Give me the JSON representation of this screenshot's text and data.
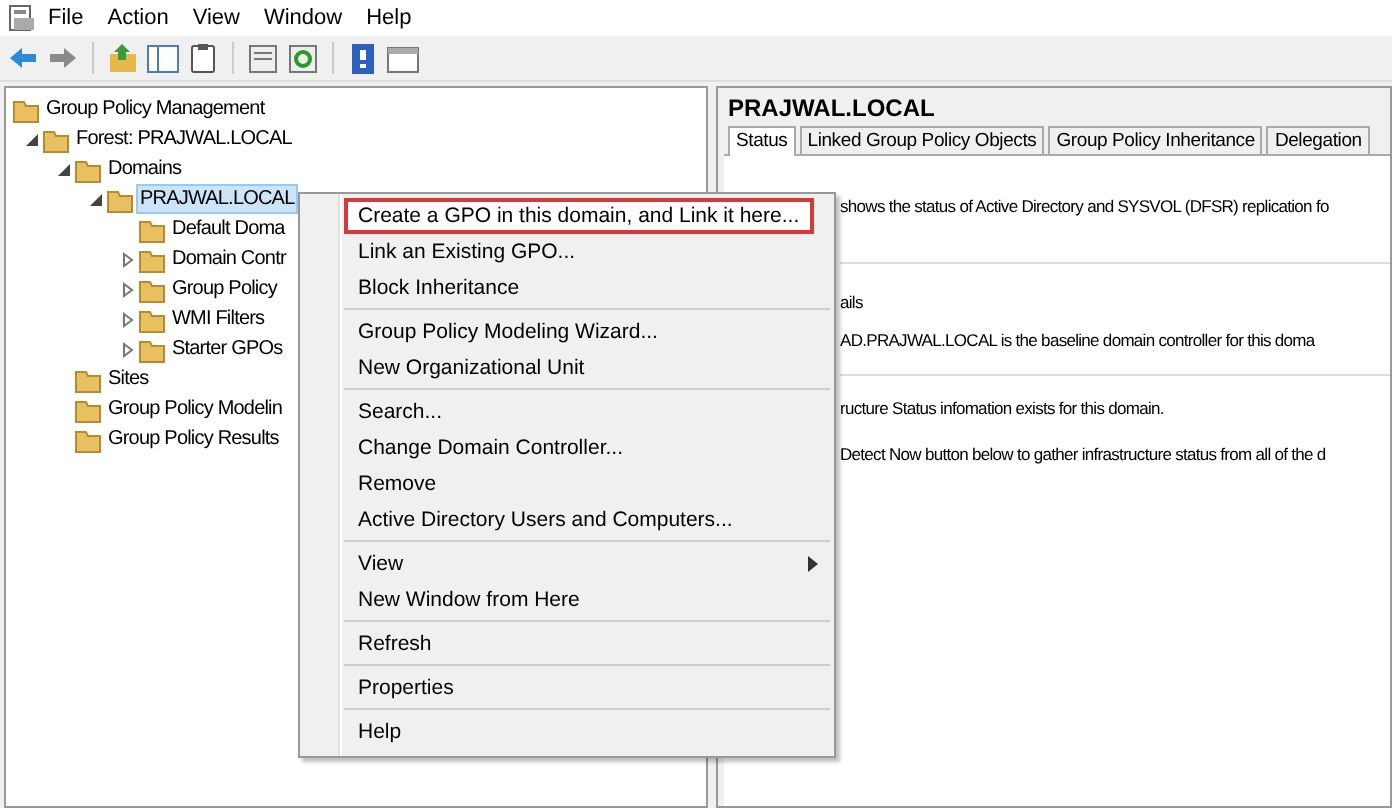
{
  "menu_bar": [
    "File",
    "Action",
    "View",
    "Window",
    "Help"
  ],
  "tree": [
    {
      "label": "Group Policy Management",
      "selected": false,
      "children": [
        {
          "label": "Forest: PRAJWAL.LOCAL",
          "expanded": true,
          "selected": false,
          "children": [
            {
              "label": "Domains",
              "expanded": true,
              "selected": false,
              "children": [
                {
                  "label": "PRAJWAL.LOCAL",
                  "expanded": true,
                  "selected": true,
                  "children": [
                    {
                      "label": "Default Doma",
                      "selected": false
                    },
                    {
                      "label": "Domain Contr",
                      "expanded": false,
                      "selected": false
                    },
                    {
                      "label": "Group Policy",
                      "expanded": false,
                      "selected": false
                    },
                    {
                      "label": "WMI Filters",
                      "expanded": false,
                      "selected": false
                    },
                    {
                      "label": "Starter GPOs",
                      "expanded": false,
                      "selected": false
                    }
                  ]
                }
              ]
            },
            {
              "label": "Sites",
              "selected": false
            },
            {
              "label": "Group Policy Modelin",
              "selected": false
            },
            {
              "label": "Group Policy Results",
              "selected": false
            }
          ]
        }
      ]
    }
  ],
  "details": {
    "title": "PRAJWAL.LOCAL",
    "tabs": [
      {
        "label": "Status",
        "selected": true
      },
      {
        "label": "Linked Group Policy Objects",
        "selected": false
      },
      {
        "label": "Group Policy Inheritance",
        "selected": false
      },
      {
        "label": "Delegation",
        "selected": false
      }
    ],
    "lines": [
      {
        "kind": "text",
        "text": "shows the status of Active Directory and SYSVOL (DFSR) replication fo"
      },
      {
        "kind": "heading",
        "text": "ails"
      },
      {
        "kind": "bullet",
        "text": "AD.PRAJWAL.LOCAL is the baseline domain controller for this doma"
      },
      {
        "kind": "text",
        "text": "ructure Status infomation exists for this domain."
      },
      {
        "kind": "text",
        "text": "Detect Now button below to gather infrastructure status from all of the d"
      }
    ]
  },
  "context_menu": [
    [
      {
        "label": "Create a GPO in this domain, and Link it here...",
        "highlighted": true,
        "submenu": false
      },
      {
        "label": "Link an Existing GPO...",
        "highlighted": false,
        "submenu": false
      },
      {
        "label": "Block Inheritance",
        "highlighted": false,
        "submenu": false
      }
    ],
    [
      {
        "label": "Group Policy Modeling Wizard...",
        "highlighted": false,
        "submenu": false
      },
      {
        "label": "New Organizational Unit",
        "highlighted": false,
        "submenu": false
      }
    ],
    [
      {
        "label": "Search...",
        "highlighted": false,
        "submenu": false
      },
      {
        "label": "Change Domain Controller...",
        "highlighted": false,
        "submenu": false
      },
      {
        "label": "Remove",
        "highlighted": false,
        "submenu": false
      },
      {
        "label": "Active Directory Users and Computers...",
        "highlighted": false,
        "submenu": false
      }
    ],
    [
      {
        "label": "View",
        "highlighted": false,
        "submenu": true
      },
      {
        "label": "New Window from Here",
        "highlighted": false,
        "submenu": false
      }
    ],
    [
      {
        "label": "Refresh",
        "highlighted": false,
        "submenu": false
      }
    ],
    [
      {
        "label": "Properties",
        "highlighted": false,
        "submenu": false
      }
    ],
    [
      {
        "label": "Help",
        "highlighted": false,
        "submenu": false
      }
    ]
  ]
}
